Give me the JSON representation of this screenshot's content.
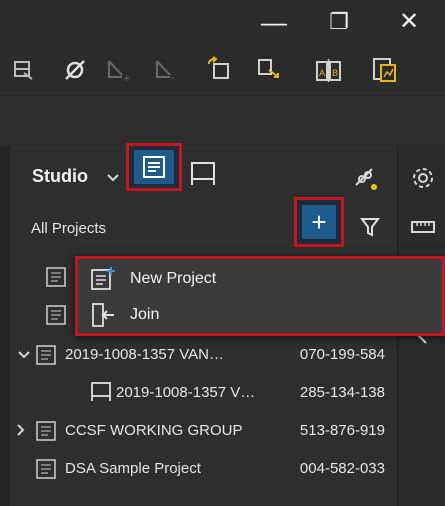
{
  "window": {
    "minimize_label": "—",
    "restore_label": "❐",
    "close_label": "✕"
  },
  "toolbar": {
    "icons": [
      "table-icon",
      "pin-icon",
      "arrow-add-icon",
      "arrow-remove-icon",
      "import-icon",
      "export-icon",
      "compare-ab-icon",
      "report-icon"
    ]
  },
  "studio": {
    "label": "Studio",
    "all_projects_label": "All Projects",
    "add_label": "+"
  },
  "popup": {
    "new_project_label": "New Project",
    "join_label": "Join"
  },
  "projects": [
    {
      "name": "2019-1008-1357 VAN…",
      "number": "070-199-584",
      "expanded": true
    },
    {
      "name": "2019-1008-1357 V…",
      "number": "285-134-138",
      "child": true
    },
    {
      "name": "CCSF WORKING GROUP",
      "number": "513-876-919",
      "expanded": false
    },
    {
      "name": "DSA Sample Project",
      "number": "004-582-033"
    }
  ],
  "colors": {
    "accent_red": "#c0161c",
    "selected_blue": "#1e5a8c",
    "link_dot": "#e6c619"
  }
}
